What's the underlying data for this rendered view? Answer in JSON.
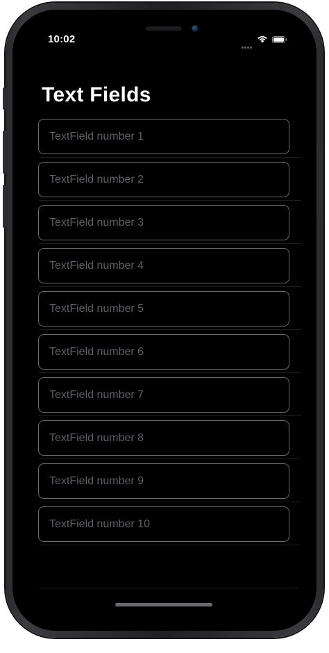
{
  "status_bar": {
    "time": "10:02"
  },
  "nav": {
    "title": "Text Fields"
  },
  "text_fields": [
    {
      "placeholder": "TextField number 1",
      "value": ""
    },
    {
      "placeholder": "TextField number 2",
      "value": ""
    },
    {
      "placeholder": "TextField number 3",
      "value": ""
    },
    {
      "placeholder": "TextField number 4",
      "value": ""
    },
    {
      "placeholder": "TextField number 5",
      "value": ""
    },
    {
      "placeholder": "TextField number 6",
      "value": ""
    },
    {
      "placeholder": "TextField number 7",
      "value": ""
    },
    {
      "placeholder": "TextField number 8",
      "value": ""
    },
    {
      "placeholder": "TextField number 9",
      "value": ""
    },
    {
      "placeholder": "TextField number 10",
      "value": ""
    }
  ],
  "icons": {
    "wifi": "wifi-icon",
    "battery": "battery-icon",
    "signal": "cellular-signal-icon"
  },
  "colors": {
    "background": "#000000",
    "field_border": "#6b6b70",
    "placeholder": "#5f5f64",
    "title": "#ffffff"
  }
}
